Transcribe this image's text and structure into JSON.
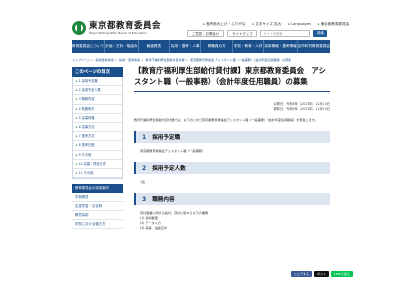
{
  "header": {
    "logo_jp": "東京都教育委員会",
    "logo_en": "Tokyo Metropolitan Board of Education",
    "top_links": [
      "音声読み上げ・ふりがな",
      "文字サイズ 拡大",
      "Languages",
      "東京都教育委員会"
    ],
    "util": {
      "mobile": "ご意見・お問合せ",
      "sitemap": "サイトマップ",
      "search_placeholder": "サイト内検索",
      "search_button": "検索"
    }
  },
  "gnav": [
    "教育委員会について",
    "計画・方針・取組み",
    "報道発表",
    "採用・選考・人事",
    "教職員の方",
    "学校・教育・人材",
    "採用情報・選考情報",
    "区市町村教育委員会"
  ],
  "breadcrumb": [
    "トップページ",
    "採用選考情報",
    "採用・選考情報",
    "教育庁福利厚生部給付貸付課",
    "東京都教育委員会 アシスタント職（一般事務）（会計年度任用職員）の募集"
  ],
  "sidebar": {
    "toc_title": "このページの目次",
    "toc": [
      "1 採用予定職",
      "2 採用予定人数",
      "3 職務内容",
      "4 勤務条件",
      "5 応募資格",
      "6 応募方法",
      "7 選考方法",
      "8 選考日程",
      "9 その他",
      "10 応募・問合せ先",
      "11 その他"
    ],
    "sec_title": "教育委員会の採用案内",
    "sec_items": [
      "学校教員",
      "生涯学習・文化財",
      "教員採用",
      "学校における働き方"
    ]
  },
  "main": {
    "title": "【教育庁福利厚生部給付貸付課】東京都教育委員会　アシスタント職（一般事務）（会計年度任用職員）の募集",
    "published": "公開日：令和5年（2023年）12月14日",
    "updated": "更新日：令和5年（2023年）12月14日",
    "intro": "教育庁福利厚生部給付貸付課では、以下のとおり東京都教育委員会アシスタント職（一般事務）（会計年度任用職員）を募集します。",
    "sections": [
      {
        "num": "1",
        "title": "採用予定職",
        "body": "東京都教育委員会アシスタント職（一般事務）"
      },
      {
        "num": "2",
        "title": "採用予定人数",
        "body": "1名"
      },
      {
        "num": "3",
        "title": "職務内容",
        "body": "貸付事業に関する給付、貸付に関する以下の業務",
        "items": [
          "(1) 資料整理",
          "(2) データ入力",
          "(3) 来客、電話応対"
        ]
      }
    ],
    "social": [
      "シェアする",
      "ポスト",
      "LINEで送る"
    ]
  }
}
